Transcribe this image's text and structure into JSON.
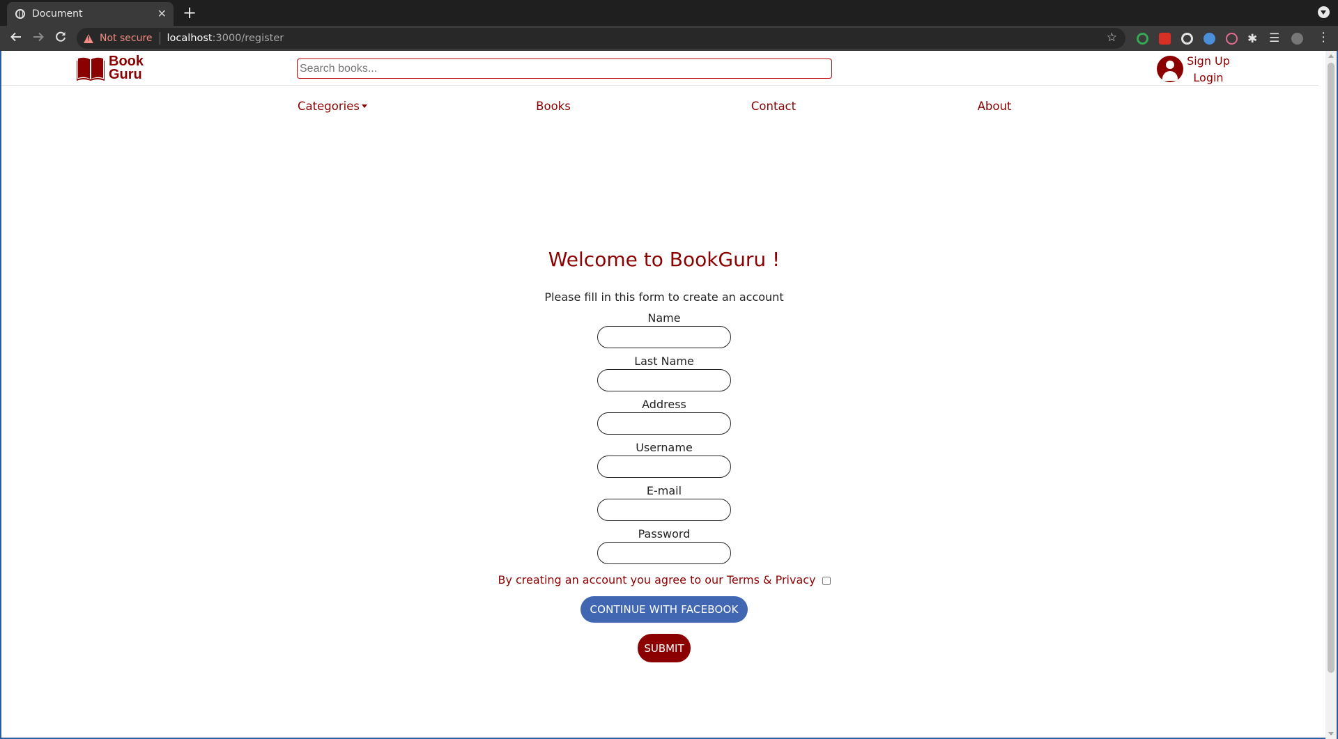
{
  "browser": {
    "tab_title": "Document",
    "tab_close": "✕",
    "new_tab": "+",
    "security_label": "Not secure",
    "url_host": "localhost",
    "url_rest": ":3000/register",
    "icons": [
      "globe-icon",
      "back-arrow-icon",
      "forward-arrow-icon",
      "reload-icon",
      "warning-icon",
      "star-icon",
      "extensions-icon",
      "menu-icon"
    ]
  },
  "header": {
    "logo_line1": "Book",
    "logo_line2": "Guru",
    "search_placeholder": "Search books...",
    "signup_label": "Sign Up",
    "login_label": "Login"
  },
  "nav": {
    "categories": "Categories",
    "books": "Books",
    "contact": "Contact",
    "about": "About"
  },
  "form": {
    "title": "Welcome to BookGuru !",
    "subtitle": "Please fill in this form to create an account",
    "fields": [
      {
        "label": "Name",
        "value": ""
      },
      {
        "label": "Last Name",
        "value": ""
      },
      {
        "label": "Address",
        "value": ""
      },
      {
        "label": "Username",
        "value": ""
      },
      {
        "label": "E-mail",
        "value": ""
      },
      {
        "label": "Password",
        "value": ""
      }
    ],
    "terms_text": "By creating an account you agree to our Terms & Privacy",
    "terms_checked": false,
    "facebook_label": "CONTINUE WITH FACEBOOK",
    "submit_label": "SUBMIT"
  },
  "colors": {
    "brand": "#8b0000",
    "facebook": "#4267b2"
  }
}
